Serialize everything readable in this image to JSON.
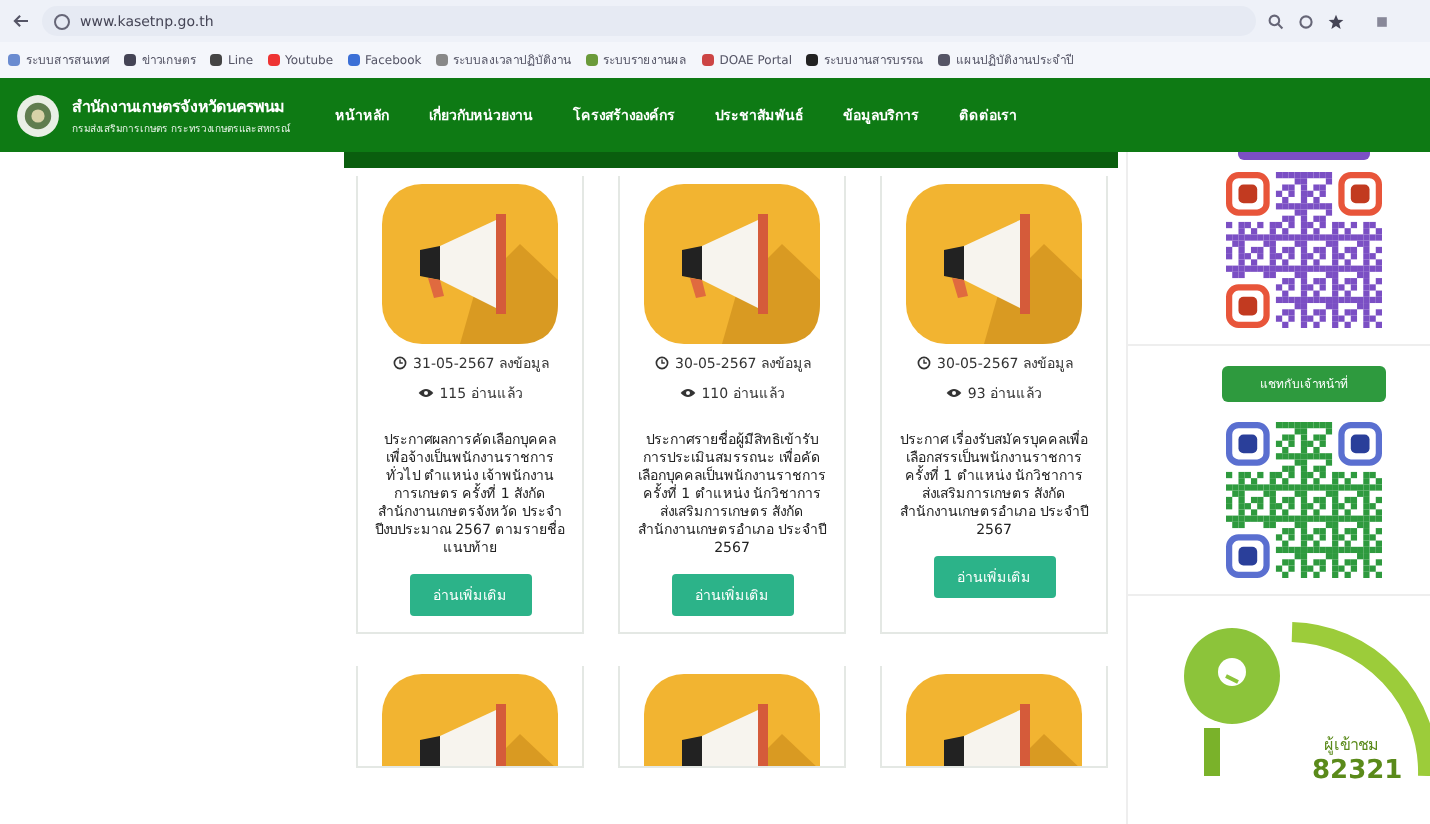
{
  "browser": {
    "url": "www.kasetnp.go.th",
    "bookmarks": [
      {
        "label": "ระบบสารสนเทศ"
      },
      {
        "label": "ข่าวเกษตร"
      },
      {
        "label": "Line"
      },
      {
        "label": "Youtube"
      },
      {
        "label": "Facebook"
      },
      {
        "label": "ระบบลงเวลาปฏิบัติงาน"
      },
      {
        "label": "ระบบรายงานผล"
      },
      {
        "label": "DOAE Portal"
      },
      {
        "label": "ระบบงานสารบรรณ"
      },
      {
        "label": "แผนปฏิบัติงานประจำปี"
      }
    ]
  },
  "header": {
    "title": "สำนักงานเกษตรจังหวัดนครพนม",
    "subtitle": "กรมส่งเสริมการเกษตร กระทรวงเกษตรและสหกรณ์",
    "nav": [
      {
        "label": "หน้าหลัก"
      },
      {
        "label": "เกี่ยวกับหน่วยงาน"
      },
      {
        "label": "โครงสร้างองค์กร"
      },
      {
        "label": "ประชาสัมพันธ์"
      },
      {
        "label": "ข้อมูลบริการ"
      },
      {
        "label": "ติดต่อเรา"
      }
    ]
  },
  "cards": [
    {
      "kind": "full",
      "date": "31-05-2567 ลงข้อมูล",
      "views": "115 อ่านแล้ว",
      "description": "ประกาศผลการคัดเลือกบุคคลเพื่อจ้างเป็นพนักงานราชการทั่วไป ตำแหน่ง เจ้าพนักงานการเกษตร ครั้งที่ 1 สังกัดสำนักงานเกษตรจังหวัด ประจำปีงบประมาณ 2567 ตามรายชื่อแนบท้าย",
      "button": "อ่านเพิ่มเติม"
    },
    {
      "kind": "full",
      "date": "30-05-2567 ลงข้อมูล",
      "views": "110 อ่านแล้ว",
      "description": "ประกาศรายชื่อผู้มีสิทธิเข้ารับการประเมินสมรรถนะ เพื่อคัดเลือกบุคคลเป็นพนักงานราชการ ครั้งที่ 1 ตำแหน่ง นักวิชาการส่งเสริมการเกษตร สังกัดสำนักงานเกษตรอำเภอ ประจำปี 2567",
      "button": "อ่านเพิ่มเติม"
    },
    {
      "kind": "full",
      "date": "30-05-2567 ลงข้อมูล",
      "views": "93 อ่านแล้ว",
      "description": "ประกาศ เรื่องรับสมัครบุคคลเพื่อเลือกสรรเป็นพนักงานราชการ ครั้งที่ 1 ตำแหน่ง นักวิชาการส่งเสริมการเกษตร สังกัดสำนักงานเกษตรอำเภอ ประจำปี 2567",
      "button": "อ่านเพิ่มเติม"
    },
    {
      "kind": "partial"
    },
    {
      "kind": "partial"
    },
    {
      "kind": "partial"
    }
  ],
  "sidebar": {
    "qr_codes": [
      {
        "color": "#7b4fc4"
      },
      {
        "label": "แชทกับเจ้าหน้าที่",
        "color": "#2e9a3e"
      }
    ],
    "counter": {
      "label": "ผู้เข้าชม",
      "value": "82321"
    }
  }
}
